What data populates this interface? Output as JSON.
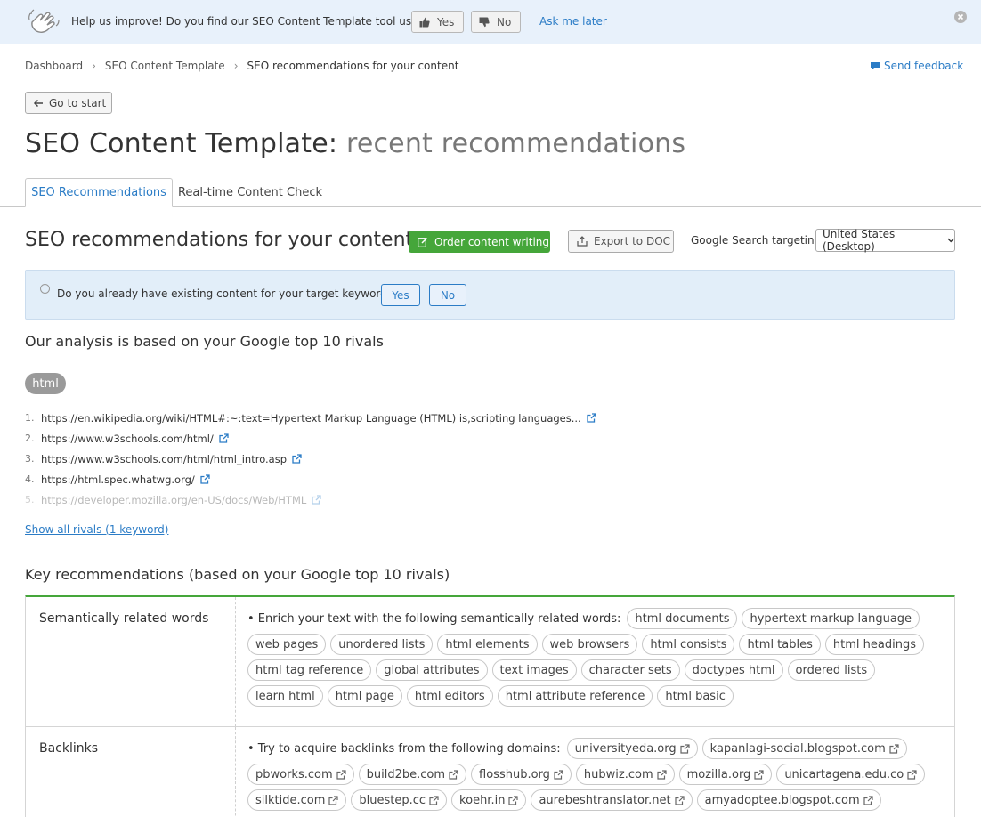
{
  "banner": {
    "message": "Help us improve! Do you find our SEO Content Template tool useful?",
    "yes_label": "Yes",
    "no_label": "No",
    "later_label": "Ask me later"
  },
  "breadcrumb": [
    "Dashboard",
    "SEO Content Template",
    "SEO recommendations for your content"
  ],
  "feedback_label": "Send feedback",
  "go_to_start_label": "Go to start",
  "title": {
    "main": "SEO Content Template:",
    "sub": "recent recommendations"
  },
  "tabs": [
    "SEO Recommendations",
    "Real-time Content Check"
  ],
  "section_title": "SEO recommendations for your content",
  "order_button": "Order content writing",
  "export_button": "Export to DOC",
  "targeting": {
    "label": "Google Search targeting:",
    "value": "United States (Desktop)"
  },
  "info": {
    "question": "Do you already have existing content for your target keywords?",
    "yes_label": "Yes",
    "no_label": "No"
  },
  "analysis_title": "Our analysis is based on your Google top 10 rivals",
  "keyword": "html",
  "rivals": [
    {
      "num": "1.",
      "url": "https://en.wikipedia.org/wiki/HTML#:~:text=Hypertext Markup Language (HTML) is,scripting languages..."
    },
    {
      "num": "2.",
      "url": "https://www.w3schools.com/html/"
    },
    {
      "num": "3.",
      "url": "https://www.w3schools.com/html/html_intro.asp"
    },
    {
      "num": "4.",
      "url": "https://html.spec.whatwg.org/"
    },
    {
      "num": "5.",
      "url": "https://developer.mozilla.org/en-US/docs/Web/HTML"
    }
  ],
  "show_all_label": "Show all rivals (1 keyword)",
  "key_recs_title": "Key recommendations (based on your Google top 10 rivals)",
  "semantic": {
    "label": "Semantically related words",
    "lead": "• Enrich your text with the following semantically related words:",
    "words": [
      "html documents",
      "hypertext markup language",
      "web pages",
      "unordered lists",
      "html elements",
      "web browsers",
      "html consists",
      "html tables",
      "html headings",
      "html tag reference",
      "global attributes",
      "text images",
      "character sets",
      "doctypes html",
      "ordered lists",
      "learn html",
      "html page",
      "html editors",
      "html attribute reference",
      "html basic"
    ]
  },
  "backlinks": {
    "label": "Backlinks",
    "lead": "• Try to acquire backlinks from the following domains:",
    "domains": [
      "universityeda.org",
      "kapanlagi-social.blogspot.com",
      "pbworks.com",
      "build2be.com",
      "flosshub.org",
      "hubwiz.com",
      "mozilla.org",
      "unicartagena.edu.co",
      "silktide.com",
      "bluestep.cc",
      "koehr.in",
      "aurebeshtranslator.net",
      "amyadoptee.blogspot.com"
    ]
  }
}
